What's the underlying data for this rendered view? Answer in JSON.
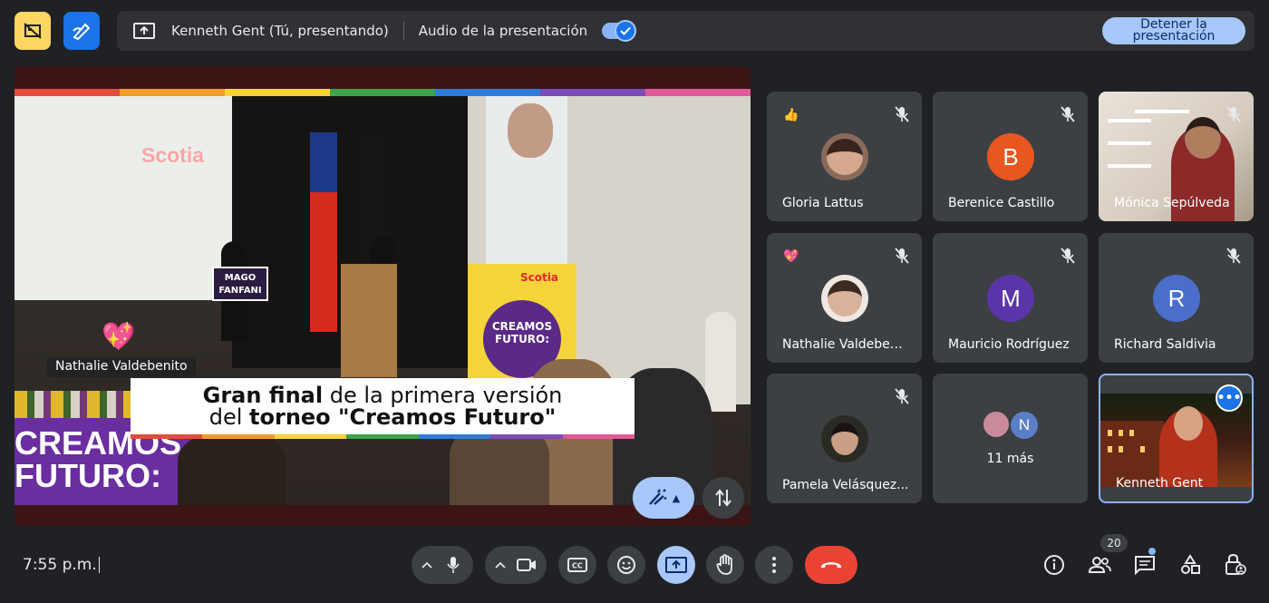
{
  "topbar": {
    "presenter_label": "Kenneth Gent (Tú, presentando)",
    "audio_label": "Audio de la presentación",
    "stop_line1": "Detener la",
    "stop_line2": "presentación"
  },
  "stage": {
    "screen_brand": "Scotia",
    "mago_line1": "MAGO",
    "mago_line2": "FANFANI",
    "sign_brand": "Scotia",
    "sign_circle_line1": "CREAMOS",
    "sign_circle_line2": "FUTURO:",
    "bigsign_line1": "CREAMOS",
    "bigsign_line2": "FUTURO:",
    "speaker_name": "Nathalie Valdebenito",
    "caption": {
      "line1_bold": "Gran final",
      "line1_rest": " de la primera versión",
      "line2_pre": "del ",
      "line2_bold": "torneo \"Creamos Futuro\""
    },
    "stripe_colors": [
      "#e44c3b",
      "#f29a2e",
      "#f7d336",
      "#3fa34d",
      "#2f7bd8",
      "#7d4cb8",
      "#e05a9a"
    ]
  },
  "participants": [
    {
      "name": "Gloria Lattus",
      "emoji": "👍",
      "type": "photo"
    },
    {
      "name": "Berenice Castillo",
      "initial": "B",
      "color": "#e8571f",
      "type": "initial"
    },
    {
      "name": "Mónica Sepúlveda",
      "type": "video"
    },
    {
      "name": "Nathalie Valdeben...",
      "emoji": "💖",
      "type": "photo"
    },
    {
      "name": "Mauricio Rodríguez",
      "initial": "M",
      "color": "#5b35a8",
      "type": "initial"
    },
    {
      "name": "Richard Saldivia",
      "initial": "R",
      "color": "#4a6ec9",
      "type": "initial"
    },
    {
      "name": "Pamela Velásquez...",
      "type": "photo"
    },
    {
      "more_label": "11 más",
      "mini_initial": "N",
      "type": "more"
    },
    {
      "name": "Kenneth Gent",
      "type": "self"
    }
  ],
  "bottombar": {
    "time": "7:55 p.m.",
    "people_count": "20"
  }
}
